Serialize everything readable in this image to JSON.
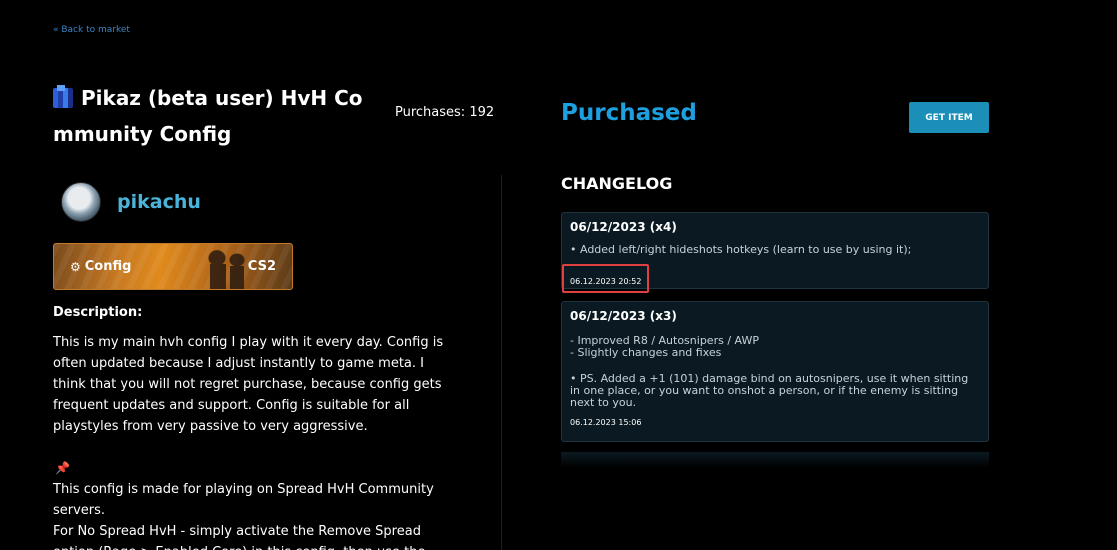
{
  "nav": {
    "back_label": "« Back to market"
  },
  "product": {
    "icon": "city-skyline-icon",
    "title": "Pikaz (beta user) HvH Community Config",
    "purchases": "Purchases: 192"
  },
  "author": {
    "name": "pikachu"
  },
  "banner": {
    "category": "Config",
    "game": "CS2",
    "accent": "#e08a1c"
  },
  "description": {
    "heading": "Description:",
    "paragraph": "This is my main hvh config I play with it every day. Config is often updated because I adjust instantly to game meta. I think that you will not regret purchase, because config gets frequent updates and support. Config is suitable for all playstyles from very passive to very aggressive.",
    "pin_icon": "pushpin-icon",
    "line_1": "This config is made for playing on Spread HvH Community servers.",
    "line_2": "For No Spread HvH - simply activate the Remove Spread option (Rage > Enabled Core) in this config, then use the"
  },
  "status": {
    "label": "Purchased",
    "color": "#1da0e0"
  },
  "actions": {
    "get_item": "GET ITEM"
  },
  "changelog": {
    "title": "CHANGELOG",
    "entries": [
      {
        "title": "06/12/2023 (x4)",
        "lines": [
          "• Added left/right hideshots hotkeys (learn to use by using it);"
        ],
        "date": "06.12.2023 20:52"
      },
      {
        "title": "06/12/2023 (x3)",
        "lines": [
          "- Improved R8 / Autosnipers / AWP",
          "- Slightly changes and fixes",
          "• PS. Added a +1 (101) damage bind on autosnipers, use it when sitting in one place, or you want to onshot a person, or if the enemy is sitting next to you."
        ],
        "date": "06.12.2023 15:06"
      }
    ]
  }
}
